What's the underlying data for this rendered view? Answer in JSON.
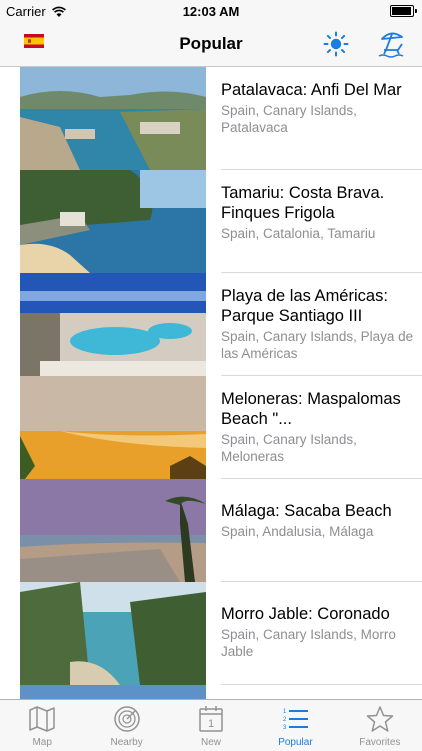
{
  "status_bar": {
    "carrier": "Carrier",
    "time": "12:03 AM"
  },
  "nav": {
    "title": "Popular",
    "flag_icon": "spain-flag-icon",
    "sun_icon": "sun-icon",
    "beach_icon": "beach-chair-icon"
  },
  "colors": {
    "accent": "#1a7de0",
    "inactive": "#929292",
    "subtitle": "#8e8e93"
  },
  "webcams": [
    {
      "title": "Patalavaca: Anfi Del Mar",
      "subtitle": "Spain, Canary Islands, Patalavaca"
    },
    {
      "title": "Tamariu: Costa Brava. Finques Frigola",
      "subtitle": "Spain, Catalonia, Tamariu"
    },
    {
      "title": "Playa de las Américas: Parque Santiago III",
      "subtitle": "Spain, Canary Islands, Playa de las Américas"
    },
    {
      "title": "Meloneras: Maspalomas Beach \"...",
      "subtitle": "Spain, Canary Islands, Meloneras"
    },
    {
      "title": "Málaga: Sacaba Beach",
      "subtitle": "Spain, Andalusia, Málaga"
    },
    {
      "title": "Morro Jable: Coronado",
      "subtitle": "Spain, Canary Islands, Morro Jable"
    }
  ],
  "tabs": [
    {
      "label": "Map",
      "icon": "map-icon"
    },
    {
      "label": "Nearby",
      "icon": "radar-icon"
    },
    {
      "label": "New",
      "icon": "calendar-icon",
      "icon_text": "1"
    },
    {
      "label": "Popular",
      "icon": "list-icon",
      "active": true
    },
    {
      "label": "Favorites",
      "icon": "star-icon"
    }
  ]
}
